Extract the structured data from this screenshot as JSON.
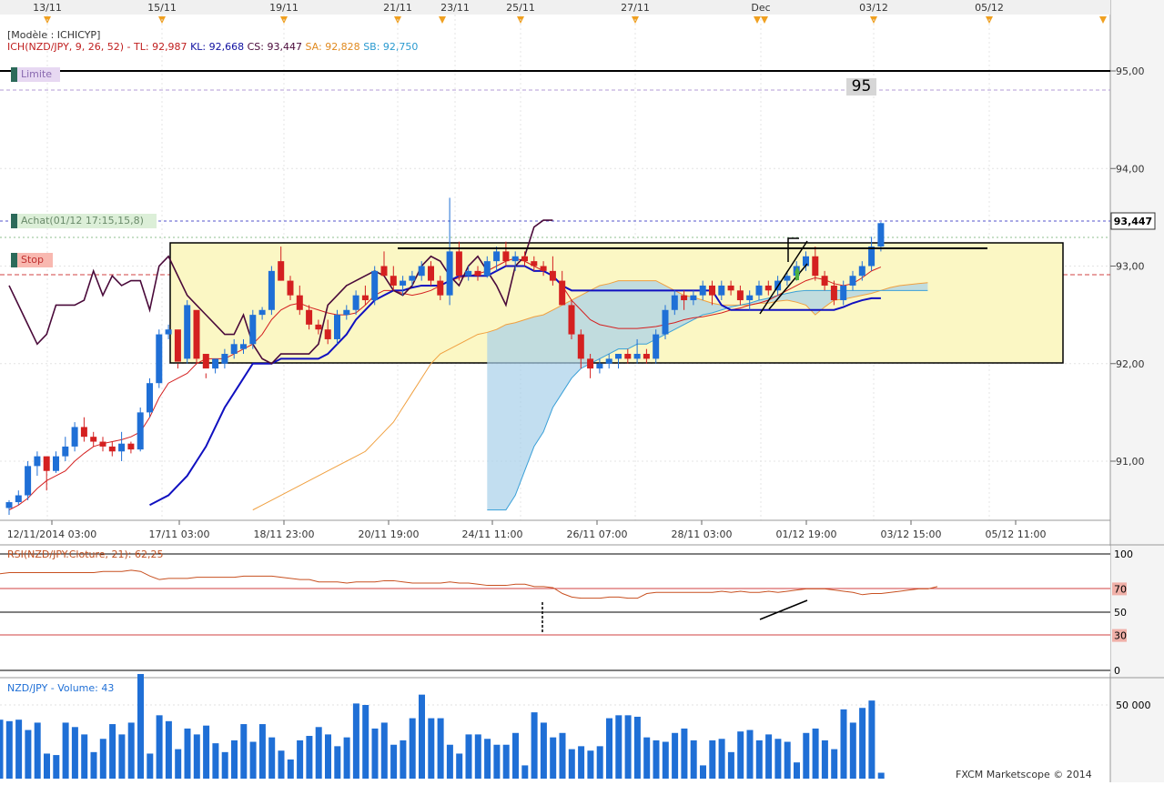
{
  "date_labels": [
    {
      "label": "13/11",
      "flag": "right"
    },
    {
      "label": "15/11",
      "flag": "right"
    },
    {
      "label": "19/11",
      "flag": "right"
    },
    {
      "label": "21/11",
      "flag": "right"
    },
    {
      "label": "23/11",
      "flag": "left"
    },
    {
      "label": "25/11",
      "flag": "right"
    },
    {
      "label": "27/11",
      "flag": "right"
    },
    {
      "label": "Dec",
      "flag": "both"
    },
    {
      "label": "03/12",
      "flag": "right"
    },
    {
      "label": "05/12",
      "flag": "right"
    }
  ],
  "header": {
    "model": "[Modèle : ICHICYP]",
    "indicator": "ICH(NZD/JPY, 9, 26, 52) -",
    "tl": "TL: 92,987",
    "kl": "KL: 92,668",
    "cs": "CS: 93,447",
    "sa": "SA: 92,828",
    "sb": "SB: 92,750"
  },
  "order_labels": {
    "limit": "Limite",
    "buy": "Achat(01/12 17:15,15,8)",
    "stop": "Stop",
    "limit_box": "95"
  },
  "price_scale": [
    "95,00",
    "94,00",
    "93,00",
    "92,00",
    "91,00"
  ],
  "current_price": "93,447",
  "time_axis": [
    "12/11/2014 03:00",
    "17/11 03:00",
    "18/11 23:00",
    "20/11 19:00",
    "24/11 11:00",
    "26/11 07:00",
    "28/11 03:00",
    "01/12 19:00",
    "03/12 15:00",
    "05/12 11:00"
  ],
  "rsi": {
    "title": "RSI(NZD/JPY.Cloture, 21): 62,25",
    "levels": [
      "100",
      "70",
      "50",
      "30",
      "0"
    ]
  },
  "volume": {
    "title": "NZD/JPY - Volume: 43",
    "scale": "50 000"
  },
  "watermark": "FXCM Marketscope © 2014",
  "colors": {
    "bull": "#1f6fd6",
    "bear": "#d42020",
    "tenkan": "#d42020",
    "kijun": "#1010c0",
    "chikou": "#4a0a3a",
    "span_a": "#f0a040",
    "span_b": "#3aa0d8",
    "kumo_bull": "#e6c070",
    "kumo_bear": "#a8d0ea"
  },
  "chart_data": [
    {
      "type": "candlestick",
      "title": "ICH(NZD/JPY, 9, 26, 52)",
      "ylim": [
        90.5,
        95.5
      ],
      "candles": [
        [
          90.52,
          90.6,
          90.45,
          90.58
        ],
        [
          90.58,
          90.7,
          90.55,
          90.65
        ],
        [
          90.65,
          91.0,
          90.6,
          90.95
        ],
        [
          90.95,
          91.1,
          90.85,
          91.05
        ],
        [
          91.05,
          91.0,
          90.7,
          90.9
        ],
        [
          90.9,
          91.1,
          90.88,
          91.05
        ],
        [
          91.05,
          91.25,
          91.0,
          91.15
        ],
        [
          91.15,
          91.4,
          91.1,
          91.35
        ],
        [
          91.35,
          91.45,
          91.2,
          91.25
        ],
        [
          91.25,
          91.3,
          91.15,
          91.2
        ],
        [
          91.2,
          91.25,
          91.1,
          91.15
        ],
        [
          91.15,
          91.2,
          91.05,
          91.1
        ],
        [
          91.1,
          91.3,
          91.0,
          91.18
        ],
        [
          91.18,
          91.2,
          91.08,
          91.12
        ],
        [
          91.12,
          91.55,
          91.1,
          91.5
        ],
        [
          91.5,
          91.85,
          91.45,
          91.8
        ],
        [
          91.8,
          92.35,
          91.75,
          92.3
        ],
        [
          92.3,
          92.4,
          92.25,
          92.35
        ],
        [
          92.35,
          92.0,
          91.95,
          92.02
        ],
        [
          92.05,
          92.65,
          92.0,
          92.6
        ],
        [
          92.55,
          92.05,
          92.0,
          92.05
        ],
        [
          92.1,
          91.9,
          91.85,
          91.95
        ],
        [
          91.95,
          92.05,
          91.9,
          92.05
        ],
        [
          92.0,
          92.15,
          91.95,
          92.1
        ],
        [
          92.1,
          92.25,
          92.05,
          92.2
        ],
        [
          92.15,
          92.25,
          92.1,
          92.2
        ],
        [
          92.2,
          92.55,
          92.15,
          92.5
        ],
        [
          92.5,
          92.58,
          92.45,
          92.55
        ],
        [
          92.55,
          93.0,
          92.5,
          92.95
        ],
        [
          93.05,
          93.2,
          92.85,
          92.85
        ],
        [
          92.85,
          92.9,
          92.65,
          92.7
        ],
        [
          92.7,
          92.8,
          92.5,
          92.55
        ],
        [
          92.55,
          92.6,
          92.35,
          92.4
        ],
        [
          92.4,
          92.45,
          92.3,
          92.35
        ],
        [
          92.35,
          92.45,
          92.2,
          92.25
        ],
        [
          92.25,
          92.55,
          92.2,
          92.5
        ],
        [
          92.5,
          92.6,
          92.45,
          92.55
        ],
        [
          92.55,
          92.75,
          92.5,
          92.7
        ],
        [
          92.7,
          92.8,
          92.6,
          92.65
        ],
        [
          92.65,
          93.0,
          92.6,
          92.95
        ],
        [
          93.0,
          93.15,
          92.9,
          92.9
        ],
        [
          92.9,
          93.0,
          92.75,
          92.8
        ],
        [
          92.8,
          92.9,
          92.7,
          92.85
        ],
        [
          92.85,
          92.95,
          92.8,
          92.9
        ],
        [
          92.9,
          93.05,
          92.85,
          93.0
        ],
        [
          93.0,
          93.05,
          92.8,
          92.85
        ],
        [
          92.85,
          92.9,
          92.65,
          92.7
        ],
        [
          92.7,
          93.7,
          92.6,
          93.15
        ],
        [
          93.15,
          93.25,
          92.85,
          92.9
        ],
        [
          92.9,
          93.0,
          92.85,
          92.95
        ],
        [
          92.95,
          93.0,
          92.85,
          92.9
        ],
        [
          92.9,
          93.1,
          92.88,
          93.05
        ],
        [
          93.05,
          93.2,
          92.95,
          93.15
        ],
        [
          93.15,
          93.25,
          93.0,
          93.05
        ],
        [
          93.05,
          93.15,
          92.95,
          93.1
        ],
        [
          93.1,
          93.15,
          93.0,
          93.05
        ],
        [
          93.05,
          93.1,
          92.95,
          93.0
        ],
        [
          93.0,
          93.05,
          92.9,
          92.95
        ],
        [
          92.95,
          93.1,
          92.8,
          92.85
        ],
        [
          92.85,
          92.95,
          92.6,
          92.6
        ],
        [
          92.6,
          92.65,
          92.25,
          92.3
        ],
        [
          92.3,
          92.35,
          91.95,
          92.05
        ],
        [
          92.05,
          92.1,
          91.85,
          91.95
        ],
        [
          91.95,
          92.05,
          91.9,
          92.0
        ],
        [
          92.0,
          92.1,
          91.95,
          92.05
        ],
        [
          92.05,
          92.1,
          91.95,
          92.1
        ],
        [
          92.1,
          92.15,
          92.0,
          92.05
        ],
        [
          92.05,
          92.25,
          92.0,
          92.1
        ],
        [
          92.1,
          92.15,
          92.0,
          92.05
        ],
        [
          92.05,
          92.35,
          92.0,
          92.3
        ],
        [
          92.3,
          92.6,
          92.25,
          92.55
        ],
        [
          92.55,
          92.75,
          92.5,
          92.7
        ],
        [
          92.7,
          92.75,
          92.55,
          92.65
        ],
        [
          92.65,
          92.75,
          92.6,
          92.7
        ],
        [
          92.7,
          92.85,
          92.65,
          92.8
        ],
        [
          92.8,
          92.85,
          92.6,
          92.7
        ],
        [
          92.7,
          92.85,
          92.65,
          92.8
        ],
        [
          92.8,
          92.85,
          92.7,
          92.75
        ],
        [
          92.75,
          92.8,
          92.6,
          92.65
        ],
        [
          92.65,
          92.75,
          92.55,
          92.7
        ],
        [
          92.7,
          92.85,
          92.65,
          92.8
        ],
        [
          92.8,
          92.85,
          92.7,
          92.75
        ],
        [
          92.75,
          92.9,
          92.7,
          92.85
        ],
        [
          92.85,
          92.95,
          92.8,
          92.9
        ],
        [
          92.9,
          93.05,
          92.85,
          93.0
        ],
        [
          93.0,
          93.15,
          92.95,
          93.1
        ],
        [
          93.1,
          93.2,
          92.85,
          92.9
        ],
        [
          92.9,
          92.95,
          92.75,
          92.8
        ],
        [
          92.8,
          92.85,
          92.6,
          92.65
        ],
        [
          92.65,
          92.85,
          92.6,
          92.8
        ],
        [
          92.8,
          92.95,
          92.75,
          92.9
        ],
        [
          92.9,
          93.05,
          92.85,
          93.0
        ],
        [
          93.0,
          93.3,
          92.95,
          93.2
        ],
        [
          93.2,
          93.45,
          93.15,
          93.44
        ]
      ],
      "tenkan": [
        90.5,
        90.55,
        90.62,
        90.72,
        90.8,
        90.85,
        90.9,
        91.0,
        91.08,
        91.15,
        91.18,
        91.2,
        91.22,
        91.25,
        91.3,
        91.45,
        91.65,
        91.8,
        91.85,
        91.9,
        92.0,
        92.05,
        92.05,
        92.05,
        92.1,
        92.15,
        92.2,
        92.3,
        92.45,
        92.55,
        92.6,
        92.62,
        92.58,
        92.55,
        92.52,
        92.5,
        92.5,
        92.52,
        92.6,
        92.7,
        92.75,
        92.75,
        92.72,
        92.7,
        92.72,
        92.75,
        92.8,
        92.85,
        92.88,
        92.9,
        92.92,
        92.95,
        93.0,
        93.05,
        93.08,
        93.05,
        93.0,
        92.95,
        92.9,
        92.8,
        92.65,
        92.55,
        92.45,
        92.4,
        92.38,
        92.36,
        92.36,
        92.36,
        92.37,
        92.38,
        92.4,
        92.42,
        92.45,
        92.47,
        92.48,
        92.5,
        92.52,
        92.55,
        92.57,
        92.6,
        92.62,
        92.65,
        92.7,
        92.75,
        92.8,
        92.85,
        92.88,
        92.86,
        92.82,
        92.8,
        92.82,
        92.88,
        92.95,
        92.99
      ],
      "kijun": [
        null,
        null,
        null,
        null,
        null,
        null,
        null,
        null,
        null,
        null,
        null,
        null,
        null,
        null,
        null,
        90.55,
        90.6,
        90.65,
        90.75,
        90.85,
        91.0,
        91.15,
        91.35,
        91.55,
        91.7,
        91.85,
        92.0,
        92.0,
        92.0,
        92.05,
        92.05,
        92.05,
        92.05,
        92.05,
        92.1,
        92.2,
        92.3,
        92.45,
        92.55,
        92.65,
        92.7,
        92.75,
        92.75,
        92.78,
        92.8,
        92.8,
        92.8,
        92.85,
        92.9,
        92.9,
        92.9,
        92.9,
        92.95,
        93.0,
        93.0,
        93.0,
        92.95,
        92.95,
        92.9,
        92.8,
        92.75,
        92.75,
        92.75,
        92.75,
        92.75,
        92.75,
        92.75,
        92.75,
        92.75,
        92.75,
        92.75,
        92.75,
        92.75,
        92.75,
        92.75,
        92.75,
        92.6,
        92.55,
        92.55,
        92.55,
        92.55,
        92.55,
        92.55,
        92.55,
        92.55,
        92.55,
        92.55,
        92.55,
        92.55,
        92.58,
        92.62,
        92.65,
        92.67,
        92.67
      ],
      "chikou": [
        92.8,
        92.6,
        92.4,
        92.2,
        92.3,
        92.6,
        92.6,
        92.6,
        92.65,
        92.95,
        92.7,
        92.9,
        92.8,
        92.85,
        92.85,
        92.55,
        93.0,
        93.1,
        92.9,
        92.7,
        92.6,
        92.5,
        92.4,
        92.3,
        92.3,
        92.5,
        92.2,
        92.05,
        92.0,
        92.1,
        92.1,
        92.1,
        92.1,
        92.2,
        92.6,
        92.7,
        92.8,
        92.85,
        92.9,
        92.95,
        92.9,
        92.75,
        92.7,
        92.8,
        93.0,
        93.1,
        93.05,
        92.9,
        92.8,
        93.0,
        93.1,
        92.95,
        92.8,
        92.6,
        93.0,
        93.1,
        93.4,
        93.47,
        93.47
      ],
      "span_a": [
        90.5,
        90.55,
        90.6,
        90.65,
        90.7,
        90.75,
        90.8,
        90.85,
        90.9,
        90.95,
        91.0,
        91.05,
        91.1,
        91.2,
        91.3,
        91.4,
        91.55,
        91.7,
        91.85,
        92.0,
        92.1,
        92.15,
        92.2,
        92.25,
        92.3,
        92.32,
        92.35,
        92.4,
        92.42,
        92.45,
        92.48,
        92.5,
        92.55,
        92.6,
        92.65,
        92.7,
        92.75,
        92.8,
        92.82,
        92.85,
        92.85,
        92.85,
        92.85,
        92.85,
        92.8,
        92.75,
        92.7,
        92.68,
        92.65,
        92.62,
        92.6,
        92.6,
        92.6,
        92.6,
        92.62,
        92.62,
        92.64,
        92.65,
        92.63,
        92.6,
        92.5,
        92.58,
        92.65,
        92.66,
        92.68,
        92.7,
        92.72,
        92.75,
        92.78,
        92.8,
        92.81,
        92.82,
        92.83
      ],
      "span_b": [
        null,
        null,
        null,
        null,
        null,
        null,
        null,
        null,
        null,
        null,
        null,
        null,
        null,
        null,
        null,
        null,
        null,
        null,
        null,
        null,
        null,
        null,
        null,
        null,
        null,
        90.5,
        90.5,
        90.5,
        90.65,
        90.9,
        91.15,
        91.3,
        91.55,
        91.7,
        91.85,
        91.95,
        92.0,
        92.05,
        92.1,
        92.15,
        92.15,
        92.2,
        92.2,
        92.25,
        92.3,
        92.35,
        92.4,
        92.45,
        92.5,
        92.52,
        92.55,
        92.58,
        92.6,
        92.62,
        92.65,
        92.67,
        92.7,
        92.72,
        92.74,
        92.75,
        92.75,
        92.75,
        92.75,
        92.75,
        92.75,
        92.75,
        92.75,
        92.75,
        92.75,
        92.75,
        92.75,
        92.75,
        92.75
      ],
      "rsi_values": [
        83,
        84,
        84,
        84,
        84,
        84,
        84,
        84,
        84,
        84,
        84,
        85,
        85,
        85,
        86,
        85,
        81,
        78,
        79,
        79,
        79,
        80,
        80,
        80,
        80,
        80,
        81,
        81,
        81,
        81,
        80,
        79,
        78,
        78,
        76,
        76,
        76,
        75,
        76,
        76,
        76,
        77,
        77,
        76,
        75,
        75,
        75,
        75,
        76,
        75,
        75,
        74,
        73,
        73,
        73,
        74,
        74,
        72,
        72,
        71,
        66,
        63,
        62,
        62,
        62,
        63,
        63,
        62,
        62,
        66,
        67,
        67,
        67,
        67,
        67,
        67,
        67,
        68,
        67,
        68,
        67,
        67,
        68,
        67,
        68,
        69,
        70,
        70,
        70,
        69,
        68,
        67,
        65,
        66,
        66,
        67,
        68,
        69,
        70,
        70,
        72
      ],
      "volume_values": [
        40000,
        39000,
        40000,
        33000,
        38000,
        17000,
        16000,
        38000,
        35000,
        30000,
        18000,
        27000,
        37000,
        30000,
        38000,
        71000,
        17000,
        43000,
        39000,
        20000,
        34000,
        30000,
        36000,
        24000,
        18000,
        26000,
        37000,
        25000,
        37000,
        28000,
        19000,
        13000,
        26000,
        29000,
        35000,
        30000,
        22000,
        28000,
        51000,
        50000,
        34000,
        38000,
        23000,
        26000,
        41000,
        57000,
        41000,
        41000,
        23000,
        17000,
        30000,
        30000,
        27000,
        23000,
        23000,
        31000,
        9000,
        45000,
        38000,
        28000,
        31000,
        20000,
        22000,
        19000,
        22000,
        41000,
        43000,
        43000,
        42000,
        28000,
        26000,
        25000,
        31000,
        34000,
        26000,
        9000,
        26000,
        27000,
        18000,
        32000,
        33000,
        26000,
        30000,
        27000,
        25000,
        11000,
        31000,
        34000,
        26000,
        20000,
        47000,
        38000,
        48000,
        53000,
        4000
      ]
    }
  ]
}
